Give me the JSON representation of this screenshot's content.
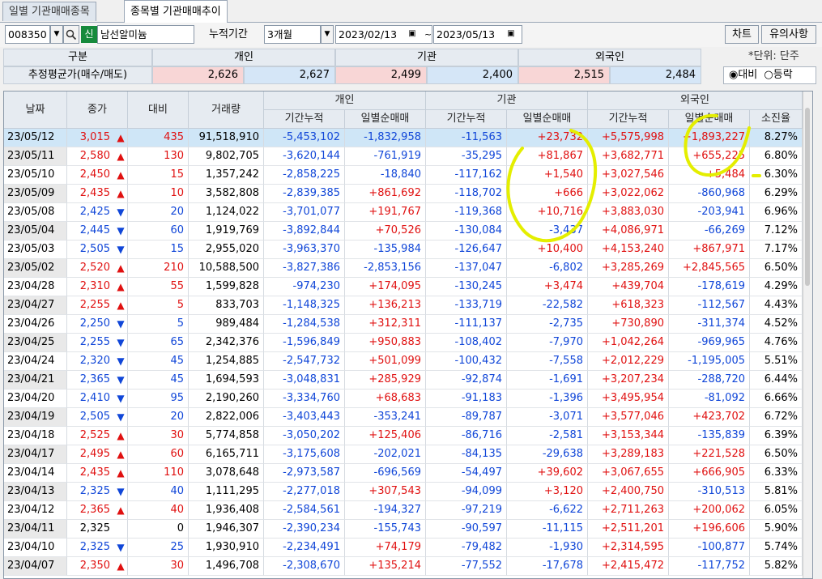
{
  "tabs": [
    {
      "label": "일별 기관매매종목",
      "active": false
    },
    {
      "label": "종목별 기관매매추이",
      "active": true
    }
  ],
  "toolbar": {
    "code": "008350",
    "company": "남선알미늄",
    "badge": "신",
    "period_label": "누적기간",
    "period_value": "3개월",
    "date_from": "2023/02/13",
    "date_sep": "~",
    "date_to": "2023/05/13",
    "chart_btn": "차트",
    "notice_btn": "유의사항",
    "unit_label": "*단위: 단주",
    "radio_1": "대비",
    "radio_2": "등락"
  },
  "summary": {
    "col_header": "구분",
    "row_label": "추정평균가(매수/매도)",
    "individual": "개인",
    "institution": "기관",
    "foreign": "외국인",
    "ind_buy": "2,626",
    "ind_sell": "2,627",
    "inst_buy": "2,499",
    "inst_sell": "2,400",
    "for_buy": "2,515",
    "for_sell": "2,484"
  },
  "grid": {
    "headers": {
      "date": "날짜",
      "close": "종가",
      "change": "대비",
      "volume": "거래량",
      "individual": "개인",
      "institution": "기관",
      "foreign": "외국인",
      "cum": "기간누적",
      "daily": "일별순매매",
      "exhaust": "소진율"
    },
    "rows": [
      [
        "23/05/12",
        "3,015",
        "up",
        "435",
        "91,518,910",
        "-5,453,102",
        "-1,832,958",
        "-11,563",
        "+23,732",
        "+5,575,998",
        "+1,893,227",
        "8.27%"
      ],
      [
        "23/05/11",
        "2,580",
        "up",
        "130",
        "9,802,705",
        "-3,620,144",
        "-761,919",
        "-35,295",
        "+81,867",
        "+3,682,771",
        "+655,225",
        "6.80%"
      ],
      [
        "23/05/10",
        "2,450",
        "up",
        "15",
        "1,357,242",
        "-2,858,225",
        "-18,840",
        "-117,162",
        "+1,540",
        "+3,027,546",
        "+5,484",
        "6.30%"
      ],
      [
        "23/05/09",
        "2,435",
        "up",
        "10",
        "3,582,808",
        "-2,839,385",
        "+861,692",
        "-118,702",
        "+666",
        "+3,022,062",
        "-860,968",
        "6.29%"
      ],
      [
        "23/05/08",
        "2,425",
        "down",
        "20",
        "1,124,022",
        "-3,701,077",
        "+191,767",
        "-119,368",
        "+10,716",
        "+3,883,030",
        "-203,941",
        "6.96%"
      ],
      [
        "23/05/04",
        "2,445",
        "down",
        "60",
        "1,919,769",
        "-3,892,844",
        "+70,526",
        "-130,084",
        "-3,437",
        "+4,086,971",
        "-66,269",
        "7.12%"
      ],
      [
        "23/05/03",
        "2,505",
        "down",
        "15",
        "2,955,020",
        "-3,963,370",
        "-135,984",
        "-126,647",
        "+10,400",
        "+4,153,240",
        "+867,971",
        "7.17%"
      ],
      [
        "23/05/02",
        "2,520",
        "up",
        "210",
        "10,588,500",
        "-3,827,386",
        "-2,853,156",
        "-137,047",
        "-6,802",
        "+3,285,269",
        "+2,845,565",
        "6.50%"
      ],
      [
        "23/04/28",
        "2,310",
        "up",
        "55",
        "1,599,828",
        "-974,230",
        "+174,095",
        "-130,245",
        "+3,474",
        "+439,704",
        "-178,619",
        "4.29%"
      ],
      [
        "23/04/27",
        "2,255",
        "up",
        "5",
        "833,703",
        "-1,148,325",
        "+136,213",
        "-133,719",
        "-22,582",
        "+618,323",
        "-112,567",
        "4.43%"
      ],
      [
        "23/04/26",
        "2,250",
        "down",
        "5",
        "989,484",
        "-1,284,538",
        "+312,311",
        "-111,137",
        "-2,735",
        "+730,890",
        "-311,374",
        "4.52%"
      ],
      [
        "23/04/25",
        "2,255",
        "down",
        "65",
        "2,342,376",
        "-1,596,849",
        "+950,883",
        "-108,402",
        "-7,970",
        "+1,042,264",
        "-969,965",
        "4.76%"
      ],
      [
        "23/04/24",
        "2,320",
        "down",
        "45",
        "1,254,885",
        "-2,547,732",
        "+501,099",
        "-100,432",
        "-7,558",
        "+2,012,229",
        "-1,195,005",
        "5.51%"
      ],
      [
        "23/04/21",
        "2,365",
        "down",
        "45",
        "1,694,593",
        "-3,048,831",
        "+285,929",
        "-92,874",
        "-1,691",
        "+3,207,234",
        "-288,720",
        "6.44%"
      ],
      [
        "23/04/20",
        "2,410",
        "down",
        "95",
        "2,190,260",
        "-3,334,760",
        "+68,683",
        "-91,183",
        "-1,396",
        "+3,495,954",
        "-81,092",
        "6.66%"
      ],
      [
        "23/04/19",
        "2,505",
        "down",
        "20",
        "2,822,006",
        "-3,403,443",
        "-353,241",
        "-89,787",
        "-3,071",
        "+3,577,046",
        "+423,702",
        "6.72%"
      ],
      [
        "23/04/18",
        "2,525",
        "up",
        "30",
        "5,774,858",
        "-3,050,202",
        "+125,406",
        "-86,716",
        "-2,581",
        "+3,153,344",
        "-135,839",
        "6.39%"
      ],
      [
        "23/04/17",
        "2,495",
        "up",
        "60",
        "6,165,711",
        "-3,175,608",
        "-202,021",
        "-84,135",
        "-29,638",
        "+3,289,183",
        "+221,528",
        "6.50%"
      ],
      [
        "23/04/14",
        "2,435",
        "up",
        "110",
        "3,078,648",
        "-2,973,587",
        "-696,569",
        "-54,497",
        "+39,602",
        "+3,067,655",
        "+666,905",
        "6.33%"
      ],
      [
        "23/04/13",
        "2,325",
        "down",
        "40",
        "1,111,295",
        "-2,277,018",
        "+307,543",
        "-94,099",
        "+3,120",
        "+2,400,750",
        "-310,513",
        "5.81%"
      ],
      [
        "23/04/12",
        "2,365",
        "up",
        "40",
        "1,936,408",
        "-2,584,561",
        "-194,327",
        "-97,219",
        "-6,622",
        "+2,711,263",
        "+200,062",
        "6.05%"
      ],
      [
        "23/04/11",
        "2,325",
        "none",
        "0",
        "1,946,307",
        "-2,390,234",
        "-155,743",
        "-90,597",
        "-11,115",
        "+2,511,201",
        "+196,606",
        "5.90%"
      ],
      [
        "23/04/10",
        "2,325",
        "down",
        "25",
        "1,930,910",
        "-2,234,491",
        "+74,179",
        "-79,482",
        "-1,930",
        "+2,314,595",
        "-100,877",
        "5.74%"
      ],
      [
        "23/04/07",
        "2,350",
        "up",
        "30",
        "1,496,708",
        "-2,308,670",
        "+135,214",
        "-77,552",
        "-17,678",
        "+2,415,472",
        "-117,752",
        "5.82%"
      ]
    ]
  },
  "colors": {
    "up": "#e01010",
    "down": "#1046d8",
    "highlight": "#cfe6f7",
    "annotation": "#e4ee00"
  }
}
